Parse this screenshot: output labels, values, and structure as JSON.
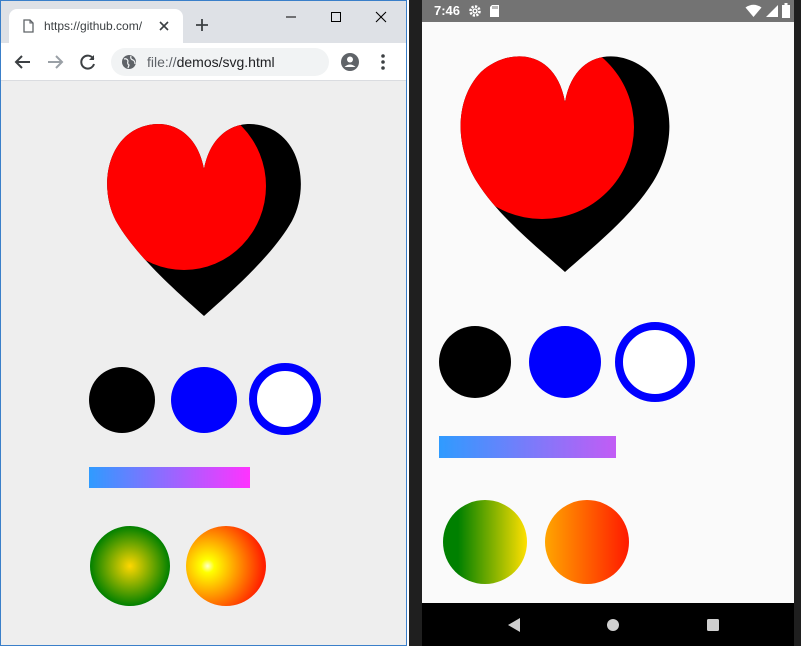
{
  "browser": {
    "tab_title": "https://github.com/",
    "url_prefix": "file://",
    "url_path": "demos/svg.html"
  },
  "phone": {
    "status_time": "7:46"
  },
  "colors": {
    "heart": "#ff0000",
    "heart_shadow": "#000000",
    "circle_black": "#000000",
    "circle_blue": "#0000ff",
    "ring_stroke": "#0000ff",
    "ring_fill": "#ffffff",
    "linear_gradient": [
      "#2f9bff",
      "#ff33ff"
    ],
    "radial_green": [
      "#ffd700",
      "#008000"
    ],
    "radial_orange": [
      "#ffff00",
      "#ff0000"
    ]
  },
  "icons": {
    "tab": "document-icon",
    "close": "close-icon",
    "new_tab": "plus-icon",
    "back": "back-arrow-icon",
    "forward": "forward-arrow-icon",
    "reload": "reload-icon",
    "site_info": "globe-icon",
    "profile": "account-circle-icon",
    "menu": "kebab-menu-icon"
  }
}
